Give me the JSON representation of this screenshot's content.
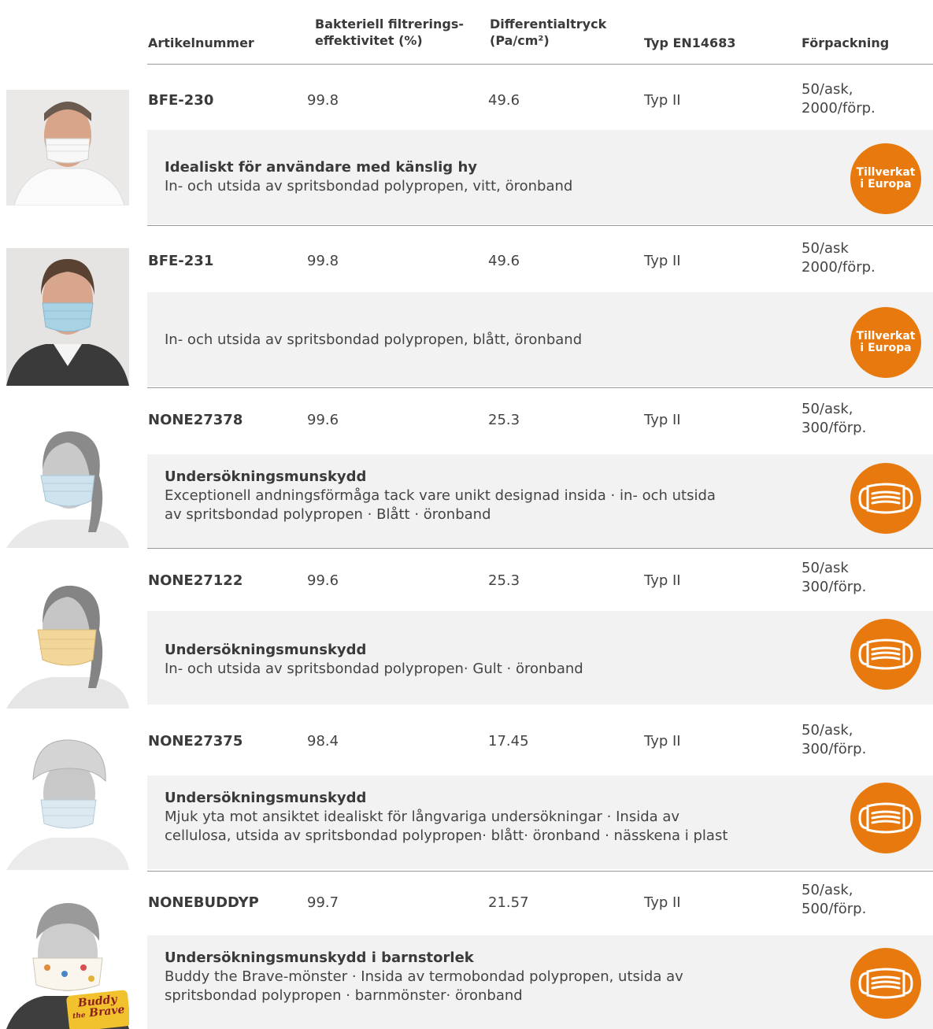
{
  "header": {
    "col1": "Artikelnummer",
    "col2_line1": "Bakteriell filtrerings-",
    "col2_line2": "effektivitet (%)",
    "col3_line1": "Differentialtryck",
    "col3_line2": "(Pa/cm²)",
    "col4": "Typ EN14683",
    "col5": "Förpackning"
  },
  "badge_europa": {
    "line1": "Tillverkat",
    "line2": "i Europa"
  },
  "colors": {
    "accent": "#e8790e",
    "panel": "#f2f2f2",
    "rule": "#9a9a9a"
  },
  "rows": [
    {
      "code": "BFE-230",
      "bfe": "99.8",
      "pressure": "49.6",
      "type": "Typ II",
      "pack1": "50/ask,",
      "pack2": "2000/förp.",
      "title": "Idealiskt för användare med känslig hy",
      "desc1": "In- och utsida av spritsbondad polypropen, vitt, öronband",
      "desc2": "",
      "badge": "europa-badge"
    },
    {
      "code": "BFE-231",
      "bfe": "99.8",
      "pressure": "49.6",
      "type": "Typ II",
      "pack1": "50/ask",
      "pack2": "2000/förp.",
      "title": "",
      "desc1": "In- och utsida av spritsbondad polypropen, blått, öronband",
      "desc2": "",
      "badge": "europa-badge"
    },
    {
      "code": "NONE27378",
      "bfe": "99.6",
      "pressure": "25.3",
      "type": "Typ II",
      "pack1": "50/ask,",
      "pack2": "300/förp.",
      "title": "Undersökningsmunskydd",
      "desc1": "Exceptionell andningsförmåga tack vare unikt designad insida · in- och utsida",
      "desc2": "av spritsbondad polypropen · Blått · öronband",
      "badge": "mask-icon"
    },
    {
      "code": "NONE27122",
      "bfe": "99.6",
      "pressure": "25.3",
      "type": "Typ II",
      "pack1": "50/ask",
      "pack2": "300/förp.",
      "title": "Undersökningsmunskydd",
      "desc1": "In- och utsida av spritsbondad polypropen· Gult · öronband",
      "desc2": "",
      "badge": "mask-icon"
    },
    {
      "code": "NONE27375",
      "bfe": "98.4",
      "pressure": "17.45",
      "type": "Typ II",
      "pack1": "50/ask,",
      "pack2": "300/förp.",
      "title": "Undersökningsmunskydd",
      "desc1": "Mjuk yta mot ansiktet idealiskt för långvariga undersökningar · Insida av",
      "desc2": "cellulosa, utsida av spritsbondad polypropen· blått· öronband · nässkena i plast",
      "badge": "mask-icon"
    },
    {
      "code": "NONEBUDDYP",
      "bfe": "99.7",
      "pressure": "21.57",
      "type": "Typ II",
      "pack1": "50/ask,",
      "pack2": "500/förp.",
      "title": "Undersökningsmunskydd i barnstorlek",
      "desc1": "Buddy the Brave-mönster · Insida av termobondad polypropen, utsida av",
      "desc2": "spritsbondad polypropen · barnmönster· öronband",
      "badge": "mask-icon",
      "logo": "Buddy the Brave"
    }
  ]
}
